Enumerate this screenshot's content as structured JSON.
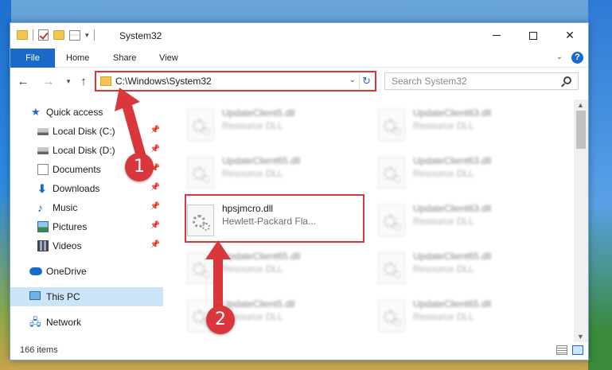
{
  "window": {
    "title": "System32",
    "controls": {
      "minimize": "—",
      "maximize": "",
      "close": "✕"
    }
  },
  "ribbon": {
    "tabs": [
      "File",
      "Home",
      "Share",
      "View"
    ],
    "help": "?"
  },
  "address_bar": {
    "path": "C:\\Windows\\System32",
    "refresh_icon": "refresh-icon"
  },
  "search": {
    "placeholder": "Search System32"
  },
  "sidebar": {
    "items": [
      {
        "label": "Quick access",
        "icon": "star-icon",
        "pinned": false
      },
      {
        "label": "Local Disk (C:)",
        "icon": "disk-icon",
        "pinned": true
      },
      {
        "label": "Local Disk (D:)",
        "icon": "disk-icon",
        "pinned": true
      },
      {
        "label": "Documents",
        "icon": "document-icon",
        "pinned": true
      },
      {
        "label": "Downloads",
        "icon": "download-icon",
        "pinned": true
      },
      {
        "label": "Music",
        "icon": "music-icon",
        "pinned": true
      },
      {
        "label": "Pictures",
        "icon": "pictures-icon",
        "pinned": true
      },
      {
        "label": "Videos",
        "icon": "videos-icon",
        "pinned": true
      },
      {
        "label": "OneDrive",
        "icon": "cloud-icon",
        "pinned": false
      },
      {
        "label": "This PC",
        "icon": "computer-icon",
        "pinned": false,
        "selected": true
      },
      {
        "label": "Network",
        "icon": "network-icon",
        "pinned": false
      }
    ]
  },
  "files": [
    {
      "name": "UpdateClient5.dll",
      "type": "Resource DLL",
      "blurred": true
    },
    {
      "name": "UpdateClient63.dll",
      "type": "Resource DLL",
      "blurred": true
    },
    {
      "name": "UpdateClient65.dll",
      "type": "Resource DLL",
      "blurred": true
    },
    {
      "name": "UpdateClient63.dll",
      "type": "Resource DLL",
      "blurred": true
    },
    {
      "name": "hpsjmcro.dll",
      "type": "Hewlett-Packard Fla...",
      "blurred": false,
      "highlighted": true
    },
    {
      "name": "UpdateClient63.dll",
      "type": "Resource DLL",
      "blurred": true
    },
    {
      "name": "UpdateClient65.dll",
      "type": "Resource DLL",
      "blurred": true
    },
    {
      "name": "UpdateClient65.dll",
      "type": "Resource DLL",
      "blurred": true
    },
    {
      "name": "UpdateClient5.dll",
      "type": "Resource DLL",
      "blurred": true
    },
    {
      "name": "UpdateClient65.dll",
      "type": "Resource DLL",
      "blurred": true
    }
  ],
  "status": {
    "item_count": "166 items"
  },
  "annotations": {
    "step1": "1",
    "step2": "2",
    "color": "#d9373b"
  }
}
